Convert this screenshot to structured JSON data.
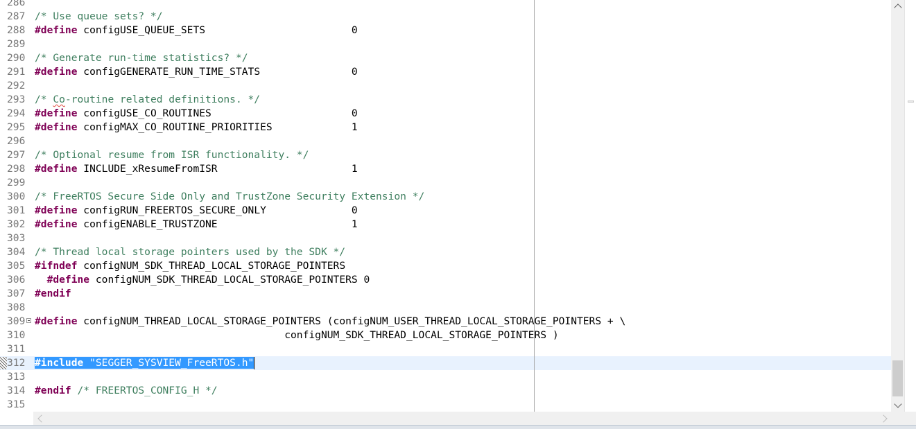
{
  "editor": {
    "lines": [
      {
        "num": "286",
        "segments": []
      },
      {
        "num": "287",
        "segments": [
          {
            "t": "cm",
            "v": "/* Use queue sets? */"
          }
        ]
      },
      {
        "num": "288",
        "segments": [
          {
            "t": "kw",
            "v": "#define"
          },
          {
            "t": "tx",
            "v": " configUSE_QUEUE_SETS                        0"
          }
        ]
      },
      {
        "num": "289",
        "segments": []
      },
      {
        "num": "290",
        "segments": [
          {
            "t": "cm",
            "v": "/* Generate run-time statistics? */"
          }
        ]
      },
      {
        "num": "291",
        "segments": [
          {
            "t": "kw",
            "v": "#define"
          },
          {
            "t": "tx",
            "v": " configGENERATE_RUN_TIME_STATS               0"
          }
        ]
      },
      {
        "num": "292",
        "segments": []
      },
      {
        "num": "293",
        "segments": [
          {
            "t": "cm",
            "v": "/* "
          },
          {
            "t": "cmsq",
            "v": "Co"
          },
          {
            "t": "cm",
            "v": "-routine related definitions. */"
          }
        ]
      },
      {
        "num": "294",
        "segments": [
          {
            "t": "kw",
            "v": "#define"
          },
          {
            "t": "tx",
            "v": " configUSE_CO_ROUTINES                       0"
          }
        ]
      },
      {
        "num": "295",
        "segments": [
          {
            "t": "kw",
            "v": "#define"
          },
          {
            "t": "tx",
            "v": " configMAX_CO_ROUTINE_PRIORITIES             1"
          }
        ]
      },
      {
        "num": "296",
        "segments": []
      },
      {
        "num": "297",
        "segments": [
          {
            "t": "cm",
            "v": "/* Optional resume from ISR functionality. */"
          }
        ]
      },
      {
        "num": "298",
        "segments": [
          {
            "t": "kw",
            "v": "#define"
          },
          {
            "t": "tx",
            "v": " INCLUDE_xResumeFromISR                      1"
          }
        ]
      },
      {
        "num": "299",
        "segments": []
      },
      {
        "num": "300",
        "segments": [
          {
            "t": "cm",
            "v": "/* FreeRTOS Secure Side Only and TrustZone Security Extension */"
          }
        ]
      },
      {
        "num": "301",
        "segments": [
          {
            "t": "kw",
            "v": "#define"
          },
          {
            "t": "tx",
            "v": " configRUN_FREERTOS_SECURE_ONLY              0"
          }
        ]
      },
      {
        "num": "302",
        "segments": [
          {
            "t": "kw",
            "v": "#define"
          },
          {
            "t": "tx",
            "v": " configENABLE_TRUSTZONE                      1"
          }
        ]
      },
      {
        "num": "303",
        "segments": []
      },
      {
        "num": "304",
        "segments": [
          {
            "t": "cm",
            "v": "/* Thread local storage pointers used by the SDK */"
          }
        ]
      },
      {
        "num": "305",
        "segments": [
          {
            "t": "kw",
            "v": "#ifndef"
          },
          {
            "t": "tx",
            "v": " configNUM_SDK_THREAD_LOCAL_STORAGE_POINTERS"
          }
        ]
      },
      {
        "num": "306",
        "segments": [
          {
            "t": "tx",
            "v": "  "
          },
          {
            "t": "kw",
            "v": "#define"
          },
          {
            "t": "tx",
            "v": " configNUM_SDK_THREAD_LOCAL_STORAGE_POINTERS 0"
          }
        ]
      },
      {
        "num": "307",
        "segments": [
          {
            "t": "kw",
            "v": "#endif"
          }
        ]
      },
      {
        "num": "308",
        "segments": []
      },
      {
        "num": "309",
        "fold": true,
        "segments": [
          {
            "t": "kw",
            "v": "#define"
          },
          {
            "t": "tx",
            "v": " configNUM_THREAD_LOCAL_STORAGE_POINTERS (configNUM_USER_THREAD_LOCAL_STORAGE_POINTERS + \\"
          }
        ]
      },
      {
        "num": "310",
        "segments": [
          {
            "t": "tx",
            "v": "                                         configNUM_SDK_THREAD_LOCAL_STORAGE_POINTERS )"
          }
        ]
      },
      {
        "num": "311",
        "segments": []
      },
      {
        "num": "312",
        "current": true,
        "marker": true,
        "segments": [
          {
            "t": "selkw",
            "v": "#include"
          },
          {
            "t": "selstr",
            "v": " \"SEGGER_SYSVIEW_FreeRTOS.h\""
          },
          {
            "t": "cursor",
            "v": ""
          }
        ]
      },
      {
        "num": "313",
        "segments": []
      },
      {
        "num": "314",
        "segments": [
          {
            "t": "kw",
            "v": "#endif"
          },
          {
            "t": "cm",
            "v": " /* FREERTOS_CONFIG_H */"
          }
        ]
      },
      {
        "num": "315",
        "segments": []
      }
    ]
  },
  "colors": {
    "keyword": "#7f0055",
    "comment": "#3f7f5f",
    "string": "#2a00ff",
    "selection": "#3399ff",
    "current_line": "#e8f2fe",
    "line_number": "#787878"
  },
  "icons": {
    "scroll_up": "chevron-up-icon",
    "scroll_down": "chevron-down-icon",
    "scroll_left": "chevron-left-icon",
    "scroll_right": "chevron-right-icon",
    "fold": "fold-collapse-icon"
  }
}
